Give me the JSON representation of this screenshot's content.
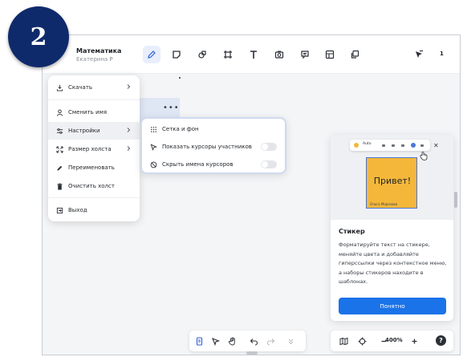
{
  "step_badge": "2",
  "board": {
    "title": "Математика",
    "owner": "Екатерина Р"
  },
  "toolbar": {
    "tools": [
      "pencil-icon",
      "sticker-icon",
      "shapes-icon",
      "frame-icon",
      "text-icon",
      "image-icon",
      "comment-icon",
      "table-icon",
      "templates-icon"
    ],
    "share_count": "1"
  },
  "menu": {
    "items": [
      {
        "label": "Скачать",
        "icon": "download-icon",
        "has_submenu": true
      },
      {
        "label": "Сменить имя",
        "icon": "user-icon",
        "has_submenu": false
      },
      {
        "label": "Настройки",
        "icon": "settings-icon",
        "has_submenu": true
      },
      {
        "label": "Размер холста",
        "icon": "resize-icon",
        "has_submenu": true
      },
      {
        "label": "Переименовать",
        "icon": "pencil-icon",
        "has_submenu": false
      },
      {
        "label": "Очистить холст",
        "icon": "trash-icon",
        "has_submenu": false
      },
      {
        "label": "Выход",
        "icon": "exit-icon",
        "has_submenu": false
      }
    ]
  },
  "submenu": {
    "items": [
      {
        "label": "Сетка и фон",
        "icon": "grid-icon"
      },
      {
        "label": "Показать курсоры участников",
        "icon": "cursor-icon",
        "toggle": false
      },
      {
        "label": "Скрыть имена курсоров",
        "icon": "hide-icon",
        "toggle": false
      }
    ]
  },
  "tip": {
    "sticker_text": "Привет!",
    "sticker_author": "Ольга Морозова",
    "mini_toolbar_label": "Auto",
    "title": "Стикер",
    "text": "Форматируйте текст на стикере, меняйте цвета и добавляйте гиперссылки через контекстное меню, а наборы стикеров находите в шаблонах.",
    "button": "Понятно"
  },
  "bottom": {
    "zoom": "400%",
    "help": "?"
  },
  "colors": {
    "accent": "#1a73e8",
    "badge": "#0f2a6b",
    "sticker": "#f4b73a",
    "selected_panel": "#dfe7f5"
  }
}
